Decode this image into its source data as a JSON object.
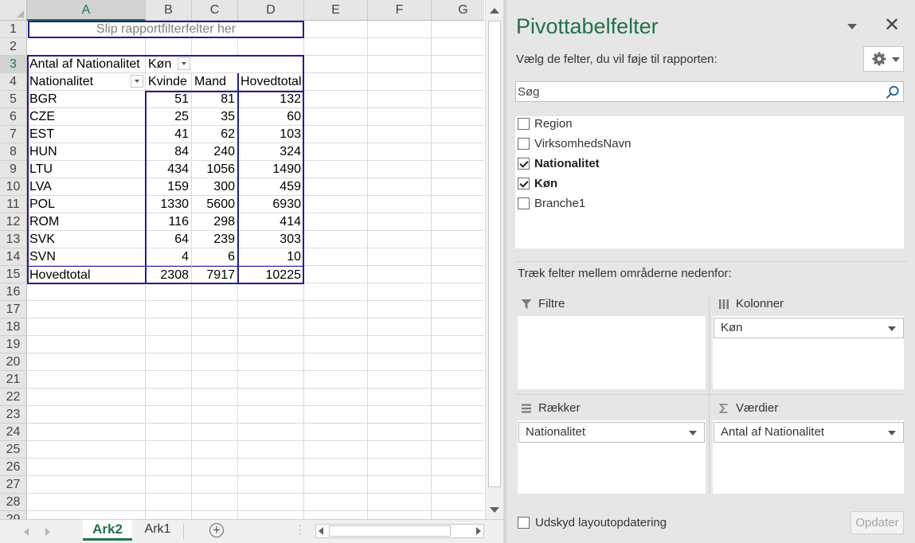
{
  "sheet": {
    "columns": [
      "A",
      "B",
      "C",
      "D",
      "E",
      "F",
      "G"
    ],
    "rows": [
      "1",
      "2",
      "3",
      "4",
      "5",
      "6",
      "7",
      "8",
      "9",
      "10",
      "11",
      "12",
      "13",
      "14",
      "15",
      "16",
      "17",
      "18",
      "19",
      "20",
      "21",
      "22",
      "23",
      "24",
      "25",
      "26",
      "27",
      "28",
      "29"
    ],
    "report_filter_placeholder": "Slip rapportfilterfelter her",
    "pivot": {
      "value_label": "Antal af Nationalitet",
      "column_field": "Køn",
      "row_field": "Nationalitet",
      "column_headers": [
        "Kvinde",
        "Mand",
        "Hovedtotal"
      ],
      "rows": [
        {
          "label": "BGR",
          "values": [
            "51",
            "81",
            "132"
          ]
        },
        {
          "label": "CZE",
          "values": [
            "25",
            "35",
            "60"
          ]
        },
        {
          "label": "EST",
          "values": [
            "41",
            "62",
            "103"
          ]
        },
        {
          "label": "HUN",
          "values": [
            "84",
            "240",
            "324"
          ]
        },
        {
          "label": "LTU",
          "values": [
            "434",
            "1056",
            "1490"
          ]
        },
        {
          "label": "LVA",
          "values": [
            "159",
            "300",
            "459"
          ]
        },
        {
          "label": "POL",
          "values": [
            "1330",
            "5600",
            "6930"
          ]
        },
        {
          "label": "ROM",
          "values": [
            "116",
            "298",
            "414"
          ]
        },
        {
          "label": "SVK",
          "values": [
            "64",
            "239",
            "303"
          ]
        },
        {
          "label": "SVN",
          "values": [
            "4",
            "6",
            "10"
          ]
        }
      ],
      "grand_total": {
        "label": "Hovedtotal",
        "values": [
          "2308",
          "7917",
          "10225"
        ]
      }
    },
    "tabs": [
      {
        "label": "Ark2",
        "active": true
      },
      {
        "label": "Ark1",
        "active": false
      }
    ]
  },
  "pane": {
    "title": "Pivottabelfelter",
    "subtitle": "Vælg de felter, du vil føje til rapporten:",
    "search_placeholder": "Søg",
    "fields": [
      {
        "label": "Region",
        "checked": false
      },
      {
        "label": "VirksomhedsNavn",
        "checked": false
      },
      {
        "label": "Nationalitet",
        "checked": true
      },
      {
        "label": "Køn",
        "checked": true
      },
      {
        "label": "Branche1",
        "checked": false
      }
    ],
    "areas_label": "Træk felter mellem områderne nedenfor:",
    "areas": {
      "filters": {
        "label": "Filtre",
        "items": []
      },
      "columns": {
        "label": "Kolonner",
        "items": [
          "Køn"
        ]
      },
      "rows": {
        "label": "Rækker",
        "items": [
          "Nationalitet"
        ]
      },
      "values": {
        "label": "Værdier",
        "items": [
          "Antal af Nationalitet"
        ]
      }
    },
    "defer_label": "Udskyd layoutopdatering",
    "update_label": "Opdater"
  },
  "colors": {
    "accent_green": "#217346",
    "pivot_border": "#1f1f8f"
  }
}
